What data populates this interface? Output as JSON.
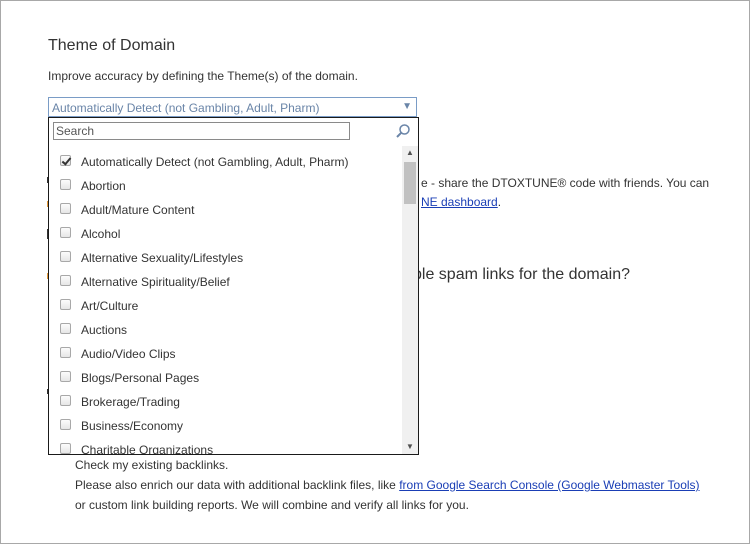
{
  "theme_section": {
    "title": "Theme of Domain",
    "description": "Improve accuracy by defining the Theme(s) of the domain.",
    "selected_value": "Automatically Detect (not Gambling, Adult, Pharm)"
  },
  "dropdown": {
    "search_placeholder": "Search",
    "options": [
      {
        "label": "Automatically Detect (not Gambling, Adult, Pharm)",
        "checked": true
      },
      {
        "label": "Abortion",
        "checked": false
      },
      {
        "label": "Adult/Mature Content",
        "checked": false
      },
      {
        "label": "Alcohol",
        "checked": false
      },
      {
        "label": "Alternative Sexuality/Lifestyles",
        "checked": false
      },
      {
        "label": "Alternative Spirituality/Belief",
        "checked": false
      },
      {
        "label": "Art/Culture",
        "checked": false
      },
      {
        "label": "Auctions",
        "checked": false
      },
      {
        "label": "Audio/Video Clips",
        "checked": false
      },
      {
        "label": "Blogs/Personal Pages",
        "checked": false
      },
      {
        "label": "Brokerage/Trading",
        "checked": false
      },
      {
        "label": "Business/Economy",
        "checked": false
      },
      {
        "label": "Charitable Organizations",
        "checked": false
      }
    ]
  },
  "background": {
    "share_text": "e - share the DTOXTUNE® code with friends. You can",
    "dashboard_link": "NE dashboard",
    "dashboard_suffix": ".",
    "question": "ple spam links for the domain?"
  },
  "backlinks": {
    "check_existing": "Check my existing backlinks.",
    "enrich_prefix": "Please also enrich our data with additional backlink files, like ",
    "gsc_link": "from Google Search Console (Google Webmaster Tools)",
    "combine_text": "or custom link building reports. We will combine and verify all links for you."
  }
}
